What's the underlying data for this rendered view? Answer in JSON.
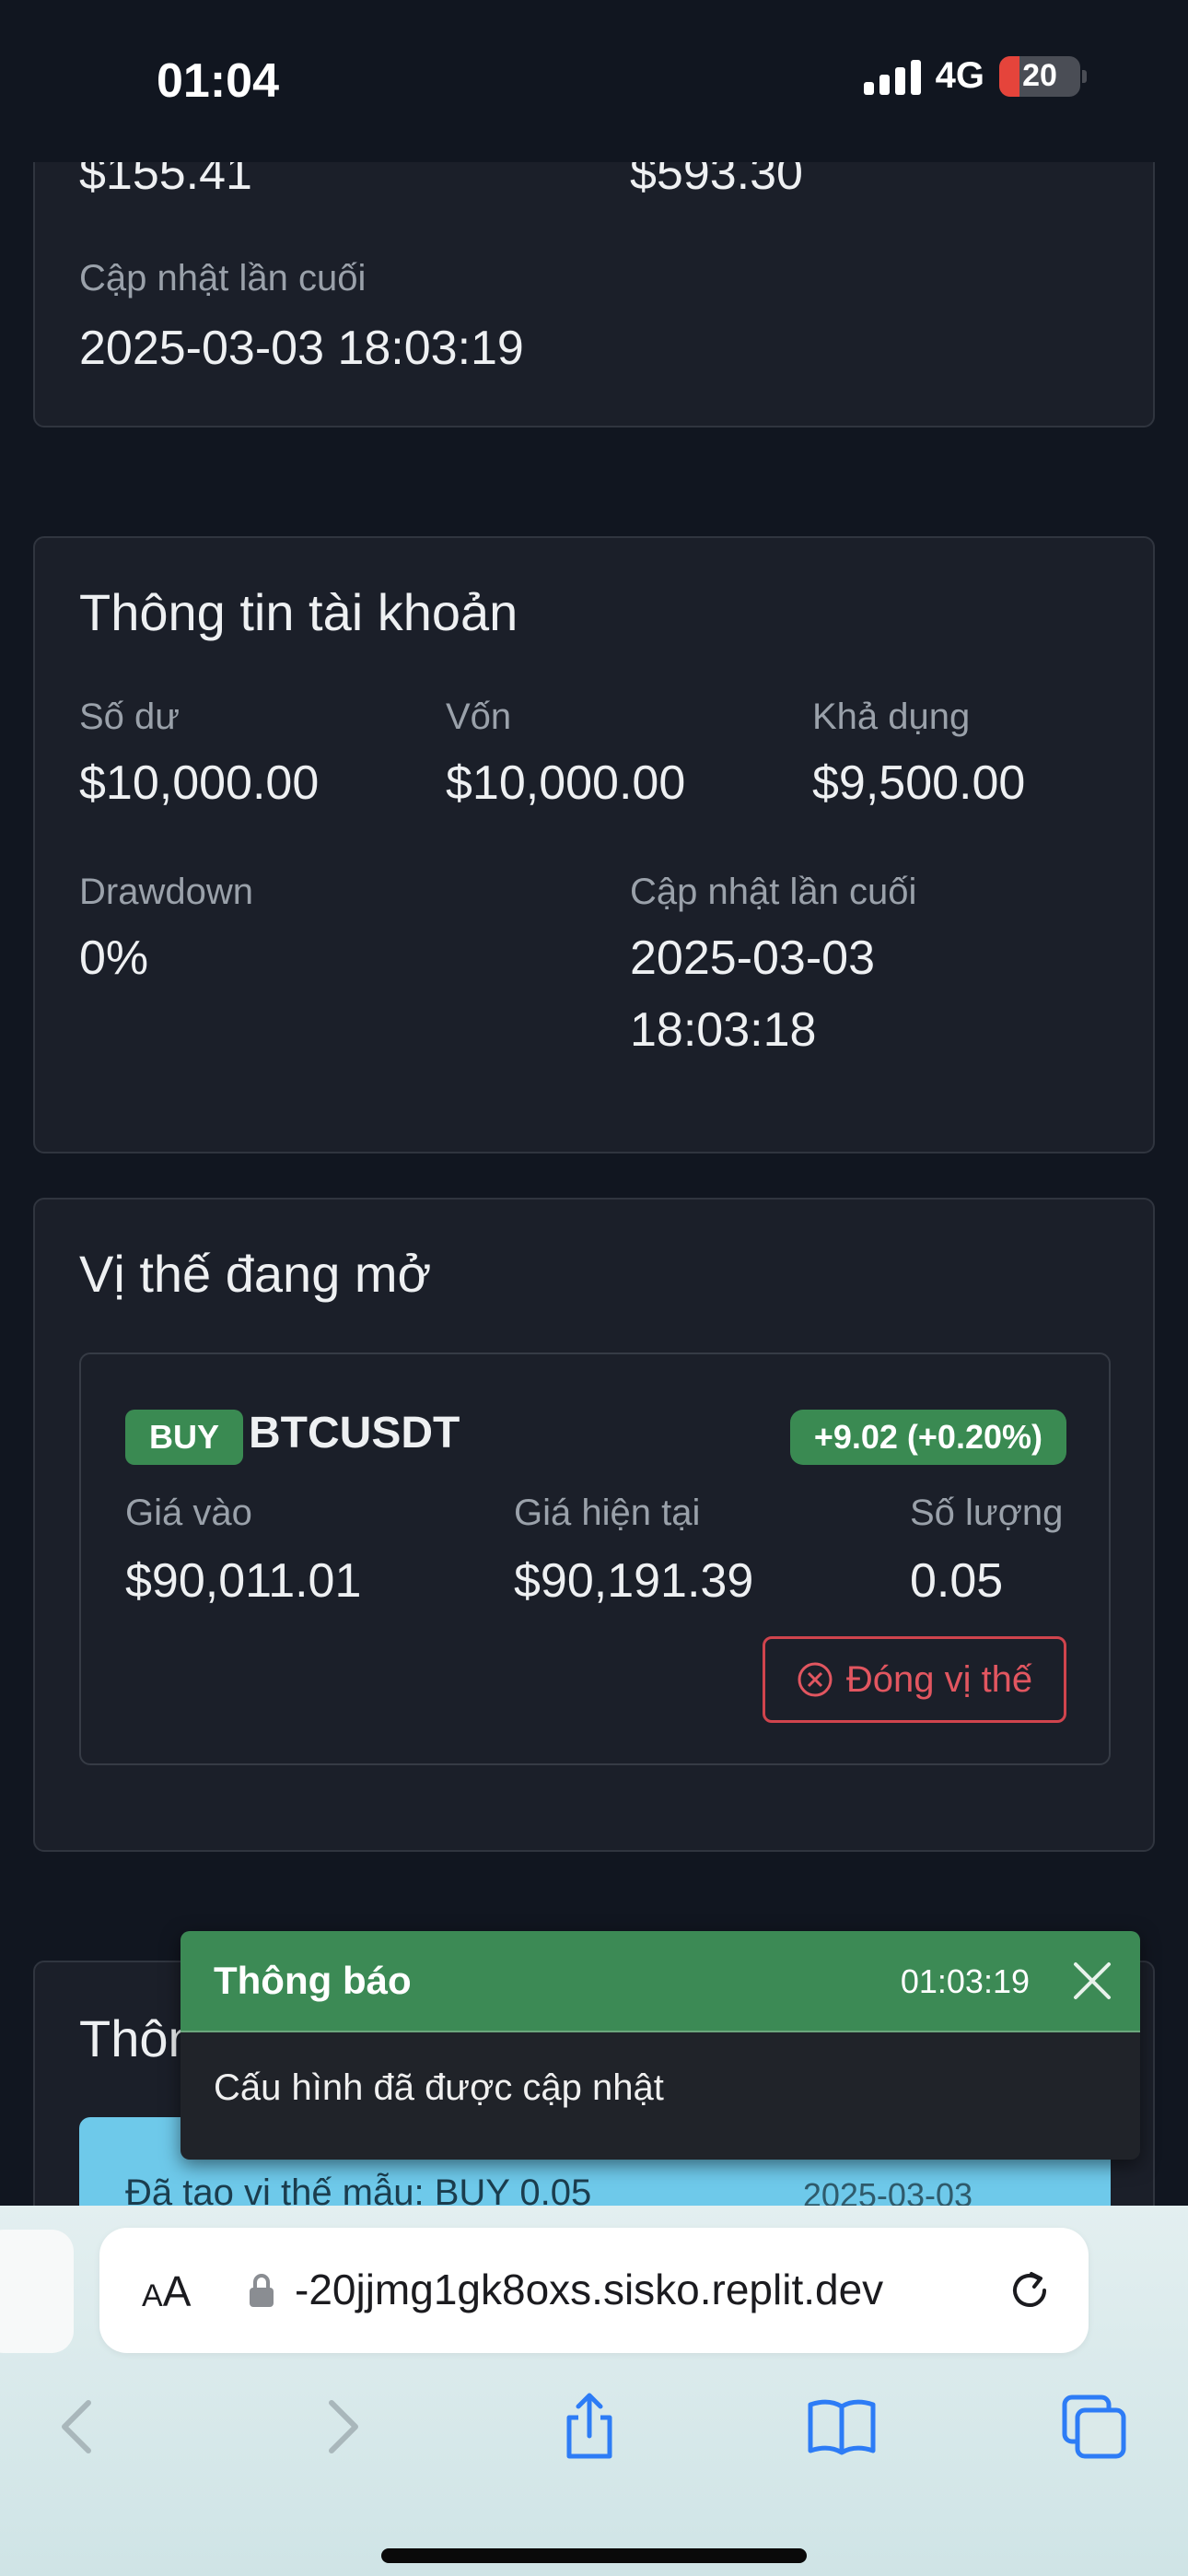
{
  "status_bar": {
    "time": "01:04",
    "network": "4G",
    "battery": "20"
  },
  "top_card": {
    "partial_value_left": "$155.41",
    "partial_value_right": "$593.30",
    "last_update_label": "Cập nhật lần cuối",
    "last_update_value": "2025-03-03 18:03:19"
  },
  "account": {
    "title": "Thông tin tài khoản",
    "balance_label": "Số dư",
    "balance_value": "$10,000.00",
    "equity_label": "Vốn",
    "equity_value": "$10,000.00",
    "available_label": "Khả dụng",
    "available_value": "$9,500.00",
    "drawdown_label": "Drawdown",
    "drawdown_value": "0%",
    "last_update_label": "Cập nhật lần cuối",
    "last_update_date": "2025-03-03",
    "last_update_time": "18:03:18"
  },
  "positions": {
    "title": "Vị thế đang mở",
    "items": [
      {
        "side": "BUY",
        "symbol": "BTCUSDT",
        "pnl": "+9.02 (+0.20%)",
        "entry_label": "Giá vào",
        "entry_value": "$90,011.01",
        "current_label": "Giá hiện tại",
        "current_value": "$90,191.39",
        "qty_label": "Số lượng",
        "qty_value": "0.05",
        "close_label": "Đóng vị thế"
      }
    ]
  },
  "log_card": {
    "title_partial": "Thôn",
    "item_text": "Đã tạo vị thế mẫu: BUY 0.05",
    "item_date": "2025-03-03"
  },
  "toast": {
    "title": "Thông báo",
    "time": "01:03:19",
    "message": "Cấu hình đã được cập nhật"
  },
  "browser": {
    "aa": "AA",
    "url": "-20jjmg1gk8oxs.sisko.replit.dev"
  },
  "colors": {
    "background": "#111620",
    "card": "#1b1f29",
    "success": "#3a8a52",
    "danger": "#d0444d",
    "info": "#6ec9ea"
  },
  "icons": [
    "signal-icon",
    "battery-icon",
    "close-circle-icon",
    "close-icon",
    "lock-icon",
    "reload-icon",
    "back-icon",
    "forward-icon",
    "share-icon",
    "bookmarks-icon",
    "tabs-icon"
  ]
}
